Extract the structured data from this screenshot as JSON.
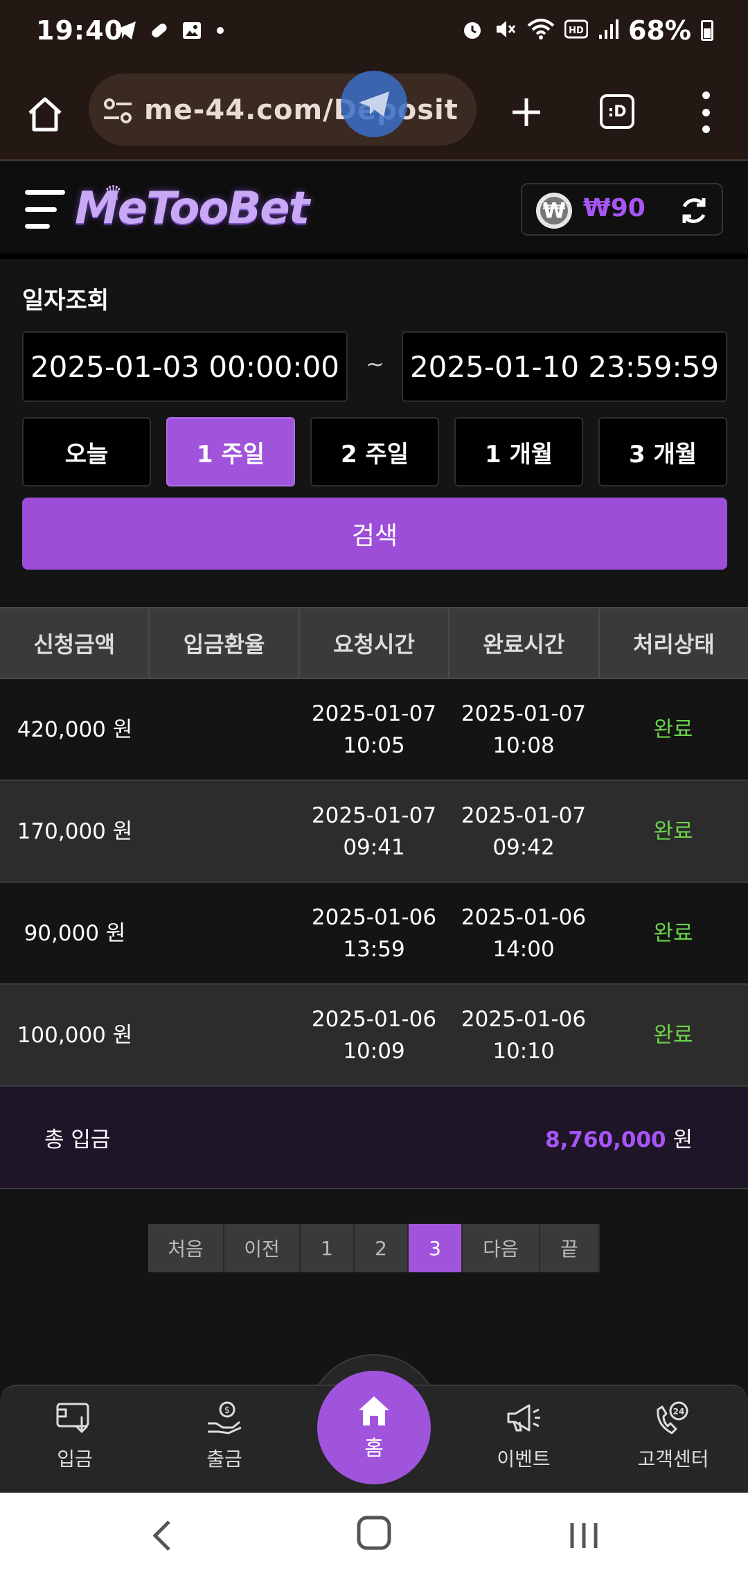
{
  "status_bar": {
    "time": "19:40",
    "battery": "68%",
    "left_icons": [
      "telegram-icon",
      "pill-icon",
      "image-icon",
      "dot-icon"
    ],
    "right_icons": [
      "alarm-icon",
      "mute-icon",
      "wifi-icon",
      "hd-icon",
      "signal-icon",
      "battery-icon"
    ]
  },
  "browser": {
    "url": "me-44.com/Deposit",
    "tab_switcher_label": ":D"
  },
  "header": {
    "logo": "MeTooBet",
    "coin_symbol": "₩",
    "balance": "₩90"
  },
  "search": {
    "title": "일자조회",
    "start_date": "2025-01-03 00:00:00",
    "separator": "~",
    "end_date": "2025-01-10 23:59:59",
    "periods": [
      "오늘",
      "1 주일",
      "2 주일",
      "1 개월",
      "3 개월"
    ],
    "active_period": "1 주일",
    "search_label": "검색"
  },
  "table": {
    "headers": [
      "신청금액",
      "입금환율",
      "요청시간",
      "완료시간",
      "처리상태"
    ],
    "rows": [
      {
        "amount": "420,000 원",
        "rate": "",
        "req_date": "2025-01-07",
        "req_time": "10:05",
        "done_date": "2025-01-07",
        "done_time": "10:08",
        "status": "완료"
      },
      {
        "amount": "170,000 원",
        "rate": "",
        "req_date": "2025-01-07",
        "req_time": "09:41",
        "done_date": "2025-01-07",
        "done_time": "09:42",
        "status": "완료"
      },
      {
        "amount": "90,000 원",
        "rate": "",
        "req_date": "2025-01-06",
        "req_time": "13:59",
        "done_date": "2025-01-06",
        "done_time": "14:00",
        "status": "완료"
      },
      {
        "amount": "100,000 원",
        "rate": "",
        "req_date": "2025-01-06",
        "req_time": "10:09",
        "done_date": "2025-01-06",
        "done_time": "10:10",
        "status": "완료"
      }
    ],
    "total_label": "총 입금",
    "total_amount": "8,760,000",
    "total_unit": "원"
  },
  "pagination": {
    "first": "처음",
    "prev": "이전",
    "pages": [
      "1",
      "2",
      "3"
    ],
    "current": "3",
    "next": "다음",
    "last": "끝"
  },
  "bottom_nav": {
    "deposit": "입금",
    "withdraw": "출금",
    "home": "홈",
    "event": "이벤트",
    "support": "고객센터"
  },
  "colors": {
    "accent": "#a054dc",
    "status_done": "#6bd44a",
    "balance": "#a855f7"
  }
}
